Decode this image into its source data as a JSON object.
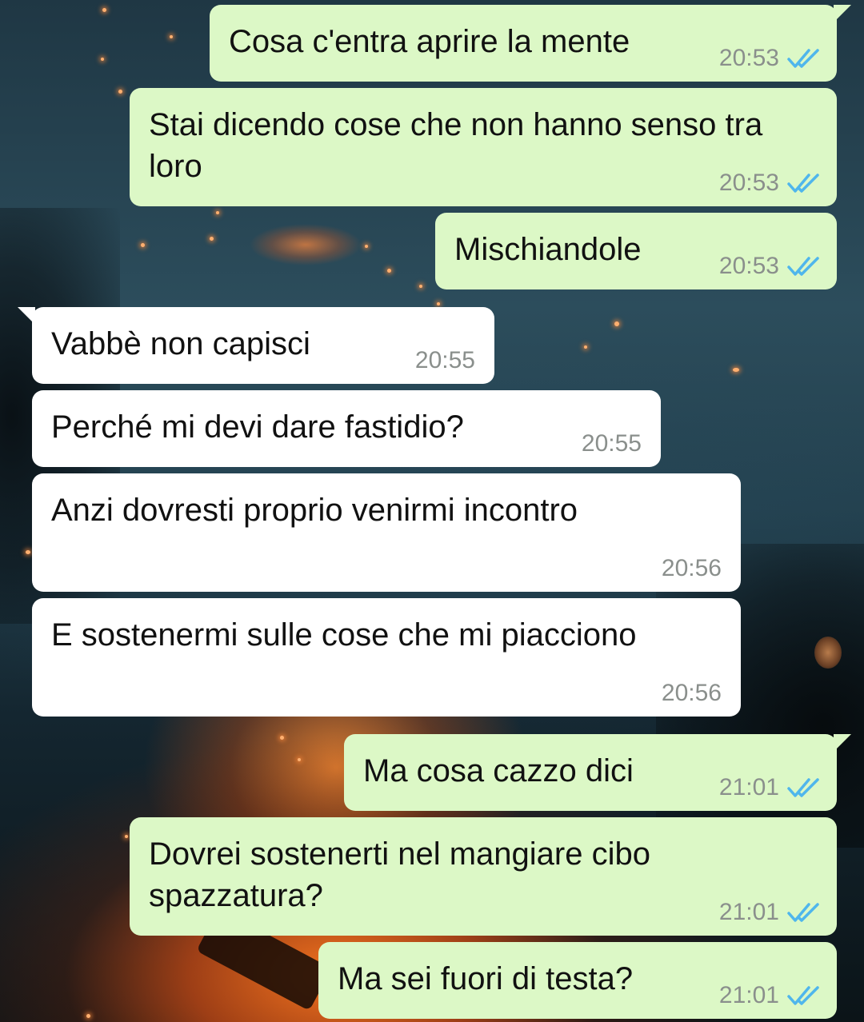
{
  "colors": {
    "outgoing_bubble": "#dcf8c6",
    "incoming_bubble": "#ffffff",
    "read_ticks": "#4fb6ec",
    "timestamp": "#8a8f8c"
  },
  "messages": [
    {
      "direction": "outgoing",
      "text": "Cosa c'entra aprire la mente",
      "time": "20:53",
      "status": "read-double-check-icon"
    },
    {
      "direction": "outgoing",
      "text": "Stai dicendo cose che non hanno senso tra loro",
      "time": "20:53",
      "status": "read-double-check-icon"
    },
    {
      "direction": "outgoing",
      "text": "Mischiandole",
      "time": "20:53",
      "status": "read-double-check-icon"
    },
    {
      "direction": "incoming",
      "text": "Vabbè non capisci",
      "time": "20:55"
    },
    {
      "direction": "incoming",
      "text": "Perché mi devi dare fastidio?",
      "time": "20:55"
    },
    {
      "direction": "incoming",
      "text": "Anzi dovresti proprio venirmi incontro",
      "time": "20:56"
    },
    {
      "direction": "incoming",
      "text": "E sostenermi sulle cose che mi piacciono",
      "time": "20:56"
    },
    {
      "direction": "outgoing",
      "text": "Ma cosa cazzo dici",
      "time": "21:01",
      "status": "read-double-check-icon"
    },
    {
      "direction": "outgoing",
      "text": "Dovrei sostenerti nel mangiare cibo spazzatura?",
      "time": "21:01",
      "status": "read-double-check-icon"
    },
    {
      "direction": "outgoing",
      "text": "Ma sei fuori di testa?",
      "time": "21:01",
      "status": "read-double-check-icon"
    }
  ]
}
